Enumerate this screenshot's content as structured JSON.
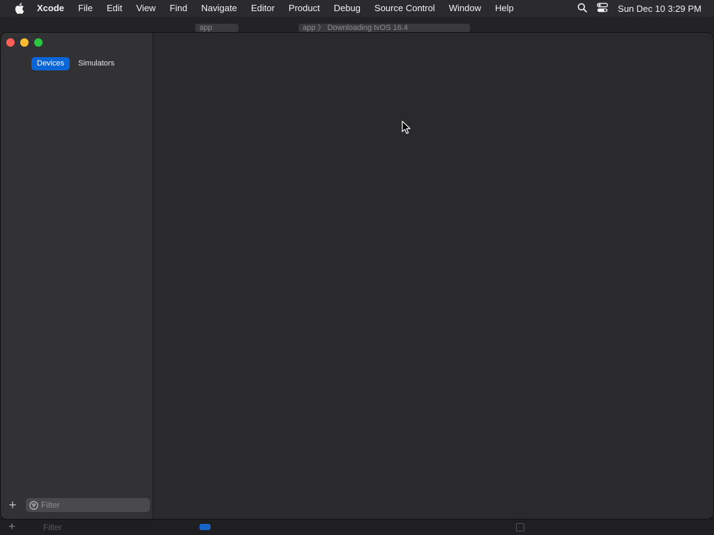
{
  "menubar": {
    "apple_icon": "apple-logo-icon",
    "app_name": "Xcode",
    "items": [
      "File",
      "Edit",
      "View",
      "Find",
      "Navigate",
      "Editor",
      "Product",
      "Debug",
      "Source Control",
      "Window",
      "Help"
    ],
    "search_icon": "magnifying-glass-icon",
    "control_center_icon": "control-center-icon",
    "clock": "Sun Dec 10  3:29 PM"
  },
  "background_window": {
    "tabs": [
      "app",
      "app 〉 Downloading tvOS 16.4"
    ],
    "filter_placeholder": "Filter",
    "add_symbol": "+"
  },
  "devices_window": {
    "traffic_lights": {
      "close_color": "#ff5f57",
      "minimize_color": "#febc2e",
      "zoom_color": "#28c840"
    },
    "segments": {
      "devices_label": "Devices",
      "simulators_label": "Simulators",
      "selected": "Devices"
    },
    "sidebar_footer": {
      "add_symbol": "+",
      "filter_placeholder": "Filter",
      "filter_value": ""
    }
  },
  "colors": {
    "accent": "#0a66d8",
    "window_bg": "#2a2a2c",
    "sidebar_bg": "#323234",
    "menubar_bg": "#2b2b2d"
  }
}
